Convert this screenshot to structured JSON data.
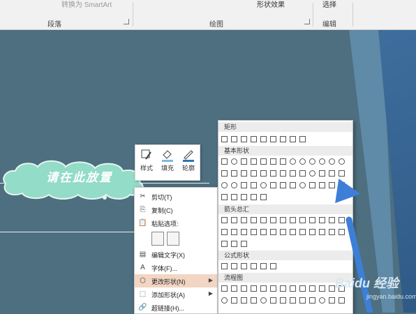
{
  "ribbon": {
    "groups": [
      "段落",
      "绘图",
      "编辑"
    ],
    "faded_item": "转换为 SmartArt",
    "shape_effect": "形状效果",
    "select": "选择"
  },
  "slide": {
    "text": "请在此放置"
  },
  "mini_toolbar": {
    "style": "样式",
    "fill": "填充",
    "outline": "轮廓"
  },
  "context_menu": {
    "items": [
      {
        "icon": "scissors-icon",
        "glyph": "✂",
        "label": "剪切(T)"
      },
      {
        "icon": "copy-icon",
        "glyph": "⎘",
        "label": "复制(C)"
      },
      {
        "icon": "paste-icon",
        "glyph": "📋",
        "label": "粘贴选项:"
      },
      {
        "icon": "edit-text-icon",
        "glyph": "▤",
        "label": "编辑文字(X)"
      },
      {
        "icon": "font-icon",
        "glyph": "A",
        "label": "字体(F)..."
      },
      {
        "icon": "change-shape-icon",
        "glyph": "⬡",
        "label": "更改形状(N)"
      },
      {
        "icon": "add-shape-icon",
        "glyph": "⬚",
        "label": "添加形状(A)"
      },
      {
        "icon": "hyperlink-icon",
        "glyph": "🔗",
        "label": "超链接(H)..."
      }
    ]
  },
  "shape_panel": {
    "sections": [
      "矩形",
      "基本形状",
      "箭头总汇",
      "公式形状",
      "流程图"
    ]
  },
  "watermark": {
    "brand": "Baidu 经验",
    "url": "jingyan.baidu.com"
  },
  "colors": {
    "slide_bg": "#4d6f80",
    "highlight": "#f3d5c3",
    "arrow": "#3d7fd6"
  }
}
